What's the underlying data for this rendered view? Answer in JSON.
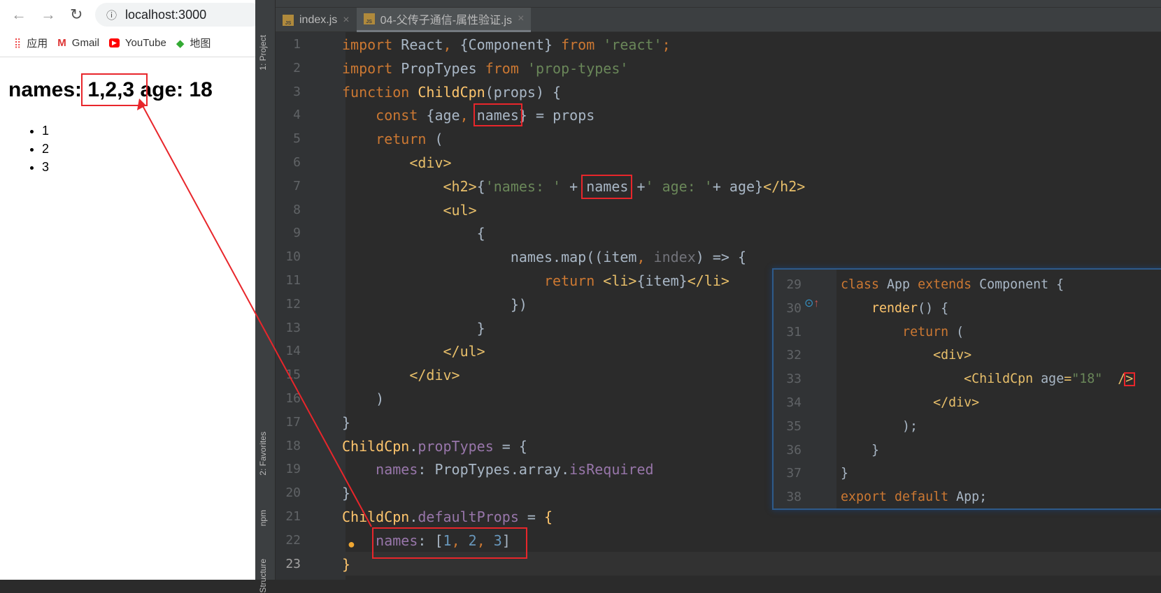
{
  "browser": {
    "url": "localhost:3000",
    "bookmarks": [
      {
        "label": "应用",
        "icon": "apps-grid-icon"
      },
      {
        "label": "Gmail",
        "icon": "gmail-icon"
      },
      {
        "label": "YouTube",
        "icon": "youtube-icon"
      },
      {
        "label": "地图",
        "icon": "maps-icon"
      }
    ],
    "heading": "names: 1,2,3 age: 18",
    "list": [
      "1",
      "2",
      "3"
    ]
  },
  "ide": {
    "side_tools": [
      "1: Project",
      "2: Favorites",
      "npm",
      "Structure"
    ],
    "tabs": [
      {
        "label": "index.js",
        "active": false
      },
      {
        "label": "04-父传子通信-属性验证.js",
        "active": true
      }
    ],
    "code_start": 1,
    "code": [
      [
        [
          "import",
          "kw"
        ],
        [
          " React",
          "tx"
        ],
        [
          ",",
          "kw"
        ],
        [
          " {Component} ",
          "tx"
        ],
        [
          "from",
          "kw"
        ],
        [
          " ",
          "tx"
        ],
        [
          "'react'",
          "str"
        ],
        [
          ";",
          "kw"
        ]
      ],
      [
        [
          "import",
          "kw"
        ],
        [
          " PropTypes ",
          "tx"
        ],
        [
          "from",
          "kw"
        ],
        [
          " ",
          "tx"
        ],
        [
          "'prop-types'",
          "str"
        ]
      ],
      [
        [
          "function",
          "kw"
        ],
        [
          " ",
          "tx"
        ],
        [
          "ChildCpn",
          "fn"
        ],
        [
          "(props) {",
          "tx"
        ]
      ],
      [
        [
          "    ",
          "tx"
        ],
        [
          "const",
          "kw"
        ],
        [
          " {age",
          "tx"
        ],
        [
          ",",
          "kw"
        ],
        [
          " names} = props",
          "tx"
        ]
      ],
      [
        [
          "    ",
          "tx"
        ],
        [
          "return",
          "kw"
        ],
        [
          " (",
          "tx"
        ]
      ],
      [
        [
          "        ",
          "tx"
        ],
        [
          "<div>",
          "tag"
        ]
      ],
      [
        [
          "            ",
          "tx"
        ],
        [
          "<h2>",
          "tag"
        ],
        [
          "{",
          "tx"
        ],
        [
          "'names: '",
          "str"
        ],
        [
          " + names +",
          "tx"
        ],
        [
          "' age: '",
          "str"
        ],
        [
          "+ age}",
          "tx"
        ],
        [
          "</h2>",
          "tag"
        ]
      ],
      [
        [
          "            ",
          "tx"
        ],
        [
          "<ul>",
          "tag"
        ]
      ],
      [
        [
          "                {",
          "tx"
        ]
      ],
      [
        [
          "                    names.map((item",
          "tx"
        ],
        [
          ",",
          "kw"
        ],
        [
          " index",
          "dim"
        ],
        [
          ") => {",
          "tx"
        ]
      ],
      [
        [
          "                        ",
          "tx"
        ],
        [
          "return",
          "kw"
        ],
        [
          " ",
          "tx"
        ],
        [
          "<li>",
          "tag"
        ],
        [
          "{item}",
          "tx"
        ],
        [
          "</li>",
          "tag"
        ]
      ],
      [
        [
          "                    })",
          "tx"
        ]
      ],
      [
        [
          "                }",
          "tx"
        ]
      ],
      [
        [
          "            ",
          "tx"
        ],
        [
          "</ul>",
          "tag"
        ]
      ],
      [
        [
          "        ",
          "tx"
        ],
        [
          "</div>",
          "tag"
        ]
      ],
      [
        [
          "    )",
          "tx"
        ]
      ],
      [
        [
          "}",
          "tx"
        ]
      ],
      [
        [
          "ChildCpn",
          "fn"
        ],
        [
          ".",
          "tx"
        ],
        [
          "propTypes",
          "prop"
        ],
        [
          " = {",
          "tx"
        ]
      ],
      [
        [
          "    ",
          "tx"
        ],
        [
          "names",
          "prop"
        ],
        [
          ": PropTypes.array.",
          "tx"
        ],
        [
          "isRequired",
          "prop"
        ]
      ],
      [
        [
          "}",
          "tx"
        ]
      ],
      [
        [
          "ChildCpn",
          "fn"
        ],
        [
          ".",
          "tx"
        ],
        [
          "defaultProps",
          "prop"
        ],
        [
          " = ",
          "tx"
        ],
        [
          "{",
          "fn"
        ]
      ],
      [
        [
          "    ",
          "tx"
        ],
        [
          "names",
          "prop"
        ],
        [
          ": [",
          "tx"
        ],
        [
          "1",
          "num"
        ],
        [
          ", ",
          "kw"
        ],
        [
          "2",
          "num"
        ],
        [
          ", ",
          "kw"
        ],
        [
          "3",
          "num"
        ],
        [
          "]",
          "tx"
        ]
      ],
      [
        [
          "}",
          "fn"
        ]
      ]
    ],
    "popup_start": 29,
    "popup_code": [
      [
        [
          "class",
          "kw"
        ],
        [
          " App ",
          "tx"
        ],
        [
          "extends",
          "kw"
        ],
        [
          " Component {",
          "tx"
        ]
      ],
      [
        [
          "    ",
          "tx"
        ],
        [
          "render",
          "fn"
        ],
        [
          "() {",
          "tx"
        ]
      ],
      [
        [
          "        ",
          "tx"
        ],
        [
          "return",
          "kw"
        ],
        [
          " (",
          "tx"
        ]
      ],
      [
        [
          "            ",
          "tx"
        ],
        [
          "<div>",
          "tag"
        ]
      ],
      [
        [
          "                ",
          "tx"
        ],
        [
          "<ChildCpn",
          "tag"
        ],
        [
          " age",
          "tx"
        ],
        [
          "=",
          "tag"
        ],
        [
          "\"18\"",
          "str"
        ],
        [
          "  ",
          "tx"
        ],
        [
          "/>",
          "tag"
        ]
      ],
      [
        [
          "            ",
          "tx"
        ],
        [
          "</div>",
          "tag"
        ]
      ],
      [
        [
          "        );",
          "tx"
        ]
      ],
      [
        [
          "    }",
          "tx"
        ]
      ],
      [
        [
          "}",
          "tx"
        ]
      ],
      [
        [
          "export default",
          "kw"
        ],
        [
          " App;",
          "tx"
        ]
      ]
    ]
  },
  "colors": {
    "annotation": "#e8262b",
    "editor_bg": "#2b2b2b",
    "keyword": "#cc7832",
    "string": "#6a8759"
  }
}
